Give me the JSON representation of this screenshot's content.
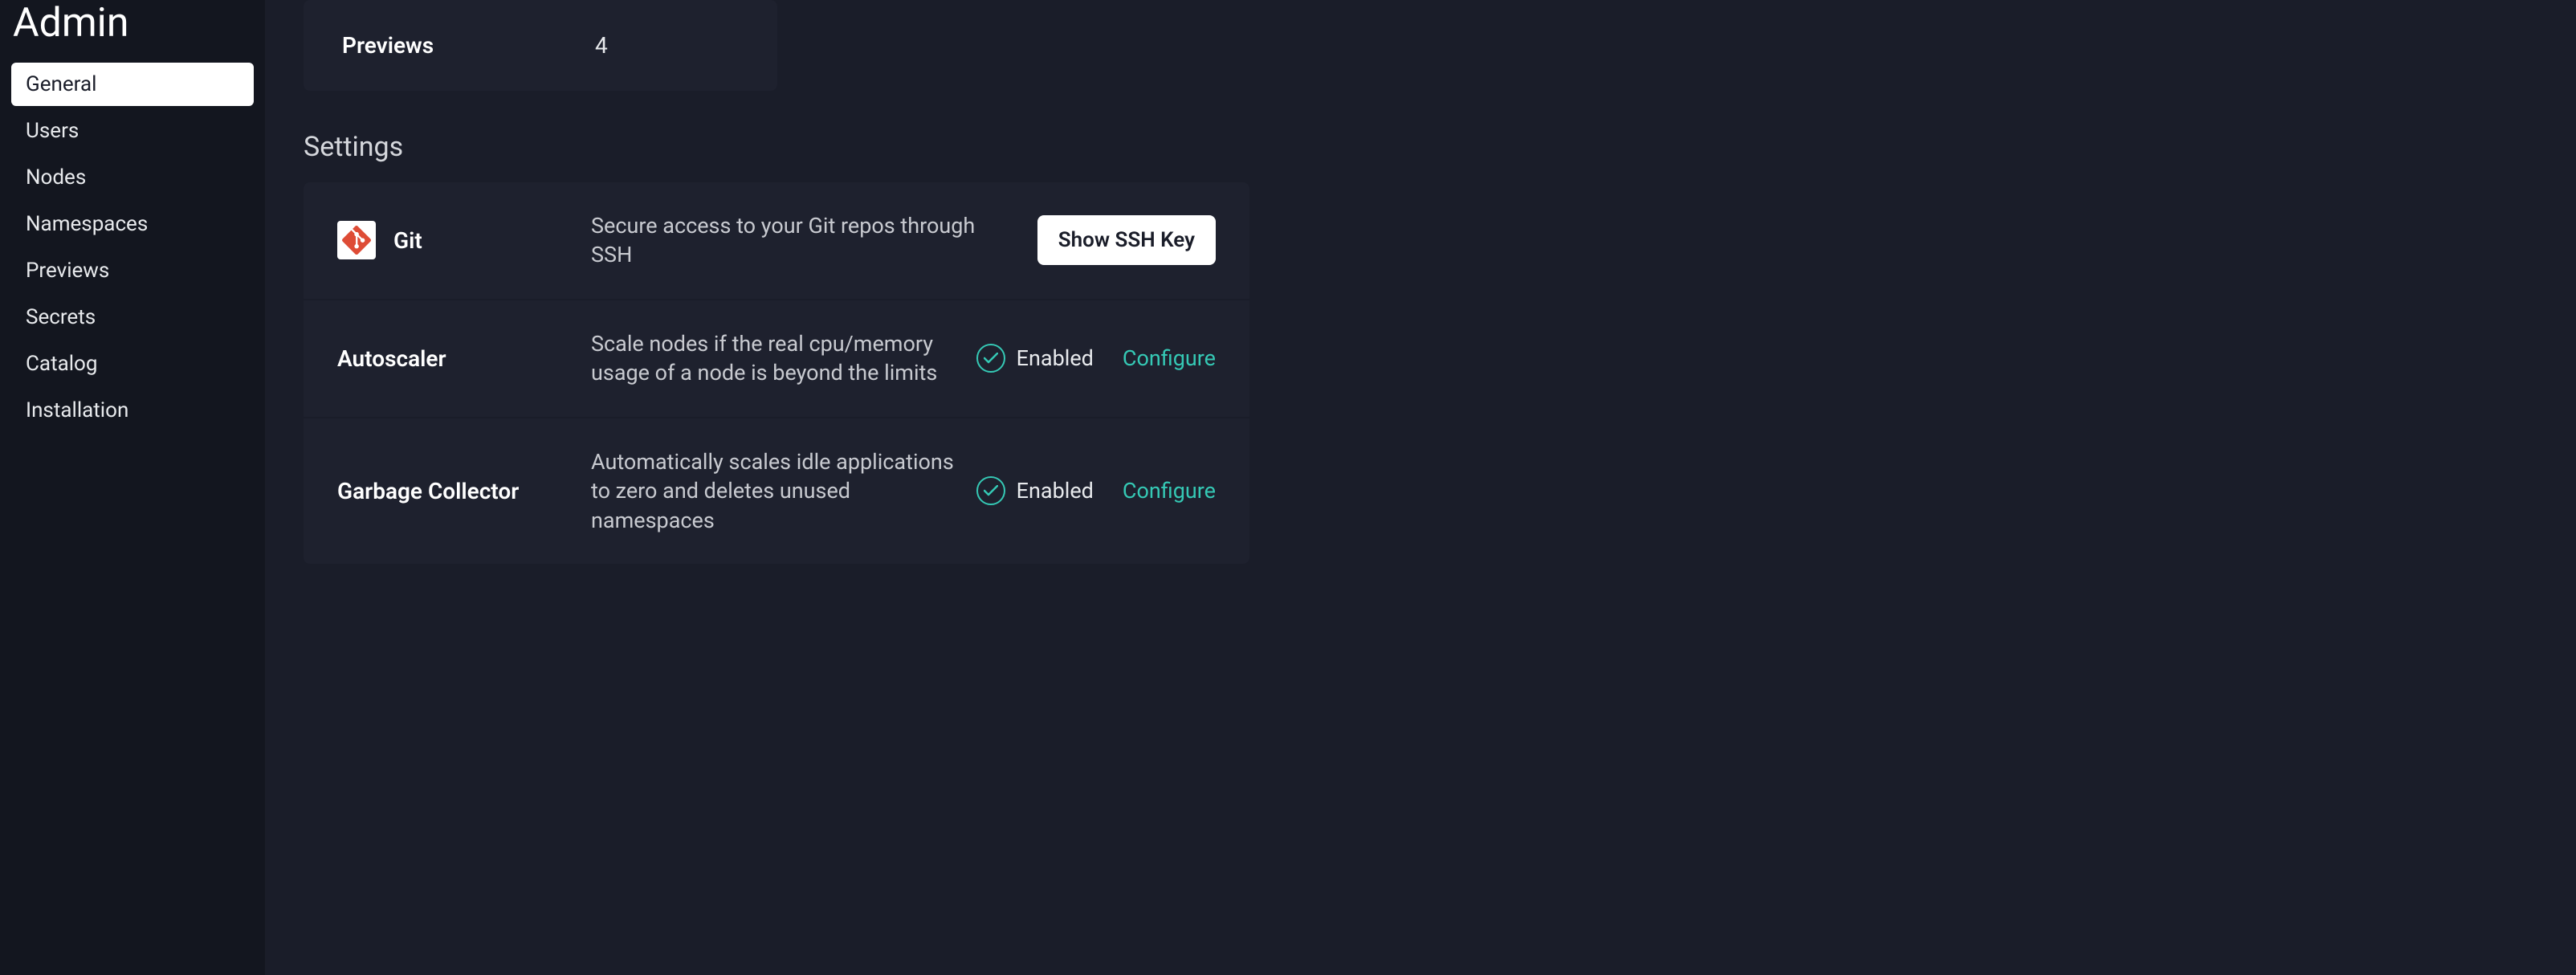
{
  "sidebar": {
    "title": "Admin",
    "items": [
      {
        "label": "General",
        "active": true
      },
      {
        "label": "Users",
        "active": false
      },
      {
        "label": "Nodes",
        "active": false
      },
      {
        "label": "Namespaces",
        "active": false
      },
      {
        "label": "Previews",
        "active": false
      },
      {
        "label": "Secrets",
        "active": false
      },
      {
        "label": "Catalog",
        "active": false
      },
      {
        "label": "Installation",
        "active": false
      }
    ]
  },
  "stat": {
    "label": "Previews",
    "value": "4"
  },
  "settings": {
    "title": "Settings",
    "rows": [
      {
        "icon": "git",
        "name": "Git",
        "description": "Secure access to your Git repos through SSH",
        "action_type": "button",
        "action_label": "Show SSH Key"
      },
      {
        "icon": null,
        "name": "Autoscaler",
        "description": "Scale nodes if the real cpu/memory usage of a node is beyond the limits",
        "status": "Enabled",
        "action_type": "link",
        "action_label": "Configure"
      },
      {
        "icon": null,
        "name": "Garbage Collector",
        "description": "Automatically scales idle applications to zero and deletes unused namespaces",
        "status": "Enabled",
        "action_type": "link",
        "action_label": "Configure"
      }
    ]
  }
}
